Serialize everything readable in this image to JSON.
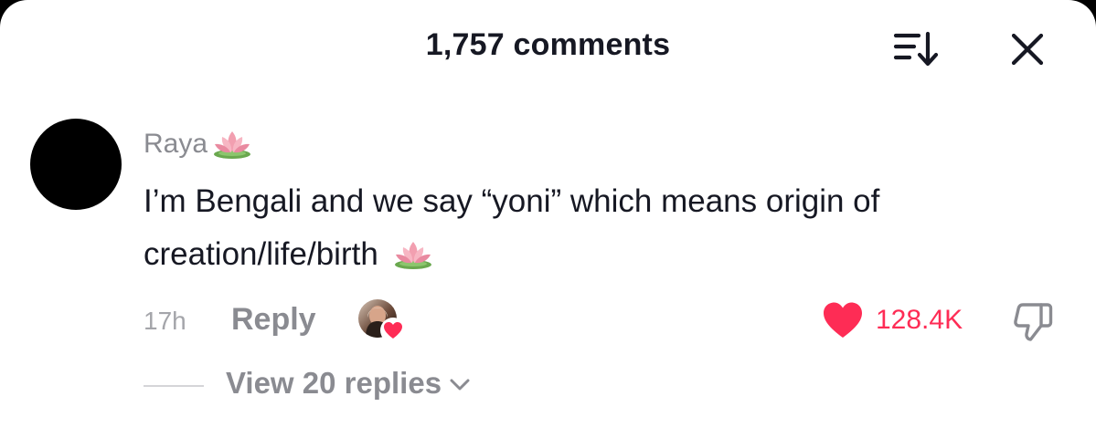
{
  "header": {
    "title": "1,757 comments",
    "sort_icon": "sort-list-icon",
    "close_icon": "close-icon"
  },
  "comment": {
    "username": "Raya",
    "username_emoji": "lotus-icon",
    "text": "I’m Bengali and we say “yoni” which means origin of creation/life/birth",
    "text_emoji": "lotus-icon",
    "timestamp": "17h",
    "reply_label": "Reply",
    "creator_liked": true,
    "like_count": "128.4K",
    "liked": true,
    "view_replies_label": "View 20 replies"
  },
  "colors": {
    "like_red": "#fe2c55",
    "primary_text": "#161823",
    "secondary_text": "#8a8b91",
    "muted_text": "#a4a5aa"
  }
}
